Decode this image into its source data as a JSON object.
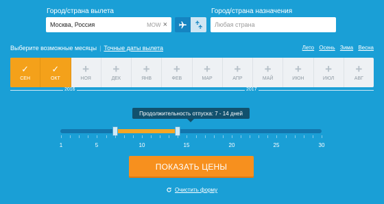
{
  "search": {
    "origin_label": "Город/страна вылета",
    "origin_value": "Москва, Россия",
    "origin_code": "MOW",
    "dest_label": "Город/страна назначения",
    "dest_placeholder": "Любая страна"
  },
  "months_row": {
    "choose_label": "Выберите возможные месяцы",
    "exact_dates_link": "Точные даты вылета",
    "seasons": [
      "Лето",
      "Осень",
      "Зима",
      "Весна"
    ]
  },
  "months": [
    {
      "label": "СЕН",
      "selected": true
    },
    {
      "label": "ОКТ",
      "selected": true
    },
    {
      "label": "НОЯ",
      "selected": false
    },
    {
      "label": "ДЕК",
      "selected": false
    },
    {
      "label": "ЯНВ",
      "selected": false
    },
    {
      "label": "ФЕВ",
      "selected": false
    },
    {
      "label": "МАР",
      "selected": false
    },
    {
      "label": "АПР",
      "selected": false
    },
    {
      "label": "МАЙ",
      "selected": false
    },
    {
      "label": "ИЮН",
      "selected": false
    },
    {
      "label": "ИЮЛ",
      "selected": false
    },
    {
      "label": "АВГ",
      "selected": false
    }
  ],
  "years": [
    "2016",
    "2017"
  ],
  "duration": {
    "tooltip": "Продолжительность отпуска: 7 - 14 дней",
    "min": 1,
    "max": 30,
    "from": 7,
    "to": 14,
    "tick_labels": [
      "1",
      "5",
      "10",
      "15",
      "20",
      "25",
      "30"
    ]
  },
  "cta_label": "ПОКАЗАТЬ ЦЕНЫ",
  "reset_label": "Очистить форму",
  "colors": {
    "background": "#1a9fd6",
    "accent": "#f7901e",
    "selected_month": "#f4a11a"
  }
}
